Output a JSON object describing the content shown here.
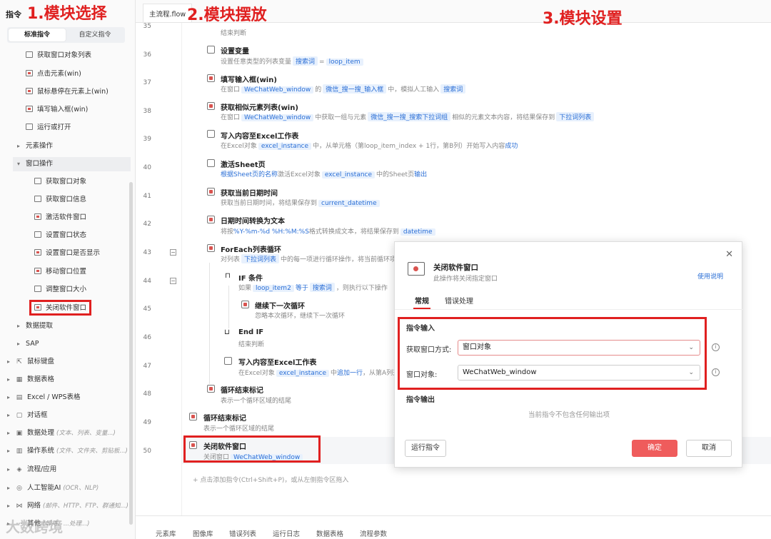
{
  "sidebar": {
    "title": "指令",
    "tabs": [
      "标准指令",
      "自定义指令"
    ],
    "items": [
      {
        "label": "获取窗口对象列表",
        "icon": "window-list-icon"
      },
      {
        "label": "点击元素(win)",
        "icon": "click-element-icon"
      },
      {
        "label": "鼠标悬停在元素上(win)",
        "icon": "hover-element-icon"
      },
      {
        "label": "填写输入框(win)",
        "icon": "fill-input-icon"
      },
      {
        "label": "运行或打开",
        "icon": "run-open-icon"
      }
    ],
    "group_element": "元素操作",
    "group_window": "窗口操作",
    "window_items": [
      {
        "label": "获取窗口对象"
      },
      {
        "label": "获取窗口信息"
      },
      {
        "label": "激活软件窗口"
      },
      {
        "label": "设置窗口状态"
      },
      {
        "label": "设置窗口是否显示"
      },
      {
        "label": "移动窗口位置"
      },
      {
        "label": "调整窗口大小"
      },
      {
        "label": "关闭软件窗口"
      }
    ],
    "group_data_extract": "数据提取",
    "group_sap": "SAP",
    "groups": [
      {
        "label": "鼠标键盘",
        "hint": ""
      },
      {
        "label": "数据表格",
        "hint": ""
      },
      {
        "label": "Excel / WPS表格",
        "hint": ""
      },
      {
        "label": "对话框",
        "hint": ""
      },
      {
        "label": "数据处理",
        "hint": "(文本、列表、变量...)"
      },
      {
        "label": "操作系统",
        "hint": "(文件、文件夹、剪贴板...)"
      },
      {
        "label": "流程/应用",
        "hint": ""
      },
      {
        "label": "人工智能AI",
        "hint": "(OCR、NLP)"
      },
      {
        "label": "网络",
        "hint": "(邮件、HTTP、FTP、群通知...)"
      },
      {
        "label": "其他",
        "hint": "(等待、...处理...)"
      }
    ]
  },
  "annotations": {
    "step1": "1.模块选择",
    "step2": "2.模块摆放",
    "step3": "3.模块设置"
  },
  "editor": {
    "tab": "主流程.flow",
    "add_hint": "+ 点击添加指令(Ctrl+Shift+P)，或从左侧指令区拖入",
    "lines": [
      "35",
      "36",
      "37",
      "38",
      "39",
      "40",
      "41",
      "42",
      "43",
      "44",
      "45",
      "46",
      "47",
      "48",
      "49",
      "50"
    ],
    "steps": {
      "s35_desc": "结束判断",
      "s36_title": "设置变量",
      "s36_desc_a": "设置任意类型的列表变量",
      "s36_var": "搜索词",
      "s36_eq": "=",
      "s36_val": "loop_item",
      "s37_title": "填写输入框(win)",
      "s37_a": "在窗口",
      "s37_win": "WeChatWeb_window",
      "s37_b": "的",
      "s37_el": "微信_搜一搜_输入框",
      "s37_c": "中，模拟人工输入",
      "s37_var": "搜索词",
      "s38_title": "获取相似元素列表(win)",
      "s38_a": "在窗口",
      "s38_win": "WeChatWeb_window",
      "s38_b": "中获取一组与元素",
      "s38_el": "微信_搜一搜_搜索下拉词组",
      "s38_c": "相似的元素文本内容，将结果保存到",
      "s38_var": "下拉词列表",
      "s39_title": "写入内容至Excel工作表",
      "s39_a": "在Excel对象",
      "s39_obj": "excel_instance",
      "s39_b": "中，从单元格（第loop_item_index + 1行，第B列）开始写入内容",
      "s39_c": "成功",
      "s40_title": "激活Sheet页",
      "s40_a": "根据Sheet页的名称",
      "s40_b": "激活Excel对象",
      "s40_obj": "excel_instance",
      "s40_c": "中的Sheet页",
      "s40_d": "输出",
      "s41_title": "获取当前日期时间",
      "s41_a": "获取当前日期时间，将结果保存到",
      "s41_var": "current_datetime",
      "s42_title": "日期时间转换为文本",
      "s42_a": "将按",
      "s42_fmt": "%Y-%m-%d %H:%M:%S",
      "s42_b": "格式转换成文本，将结果保存到",
      "s42_var": "datetime",
      "s43_title": "ForEach列表循环",
      "s43_a": "对列表",
      "s43_var": "下拉词列表",
      "s43_b": "中的每一项进行循环操作，将当前循环项",
      "s44_title": "IF 条件",
      "s44_a": "如果",
      "s44_var": "loop_item2",
      "s44_op": "等于",
      "s44_val": "搜索词",
      "s44_b": "，则执行以下操作",
      "s45_title": "继续下一次循环",
      "s45_desc": "忽略本次循环，继续下一次循环",
      "s46_title": "End IF",
      "s46_desc": "结束判断",
      "s47_title": "写入内容至Excel工作表",
      "s47_a": "在Excel对象",
      "s47_obj": "excel_instance",
      "s47_b": "中",
      "s47_c": "追加一行",
      "s47_d": "，从第A列开",
      "s48_title": "循环结束标记",
      "s48_desc": "表示一个循环区域的结尾",
      "s49_title": "循环结束标记",
      "s49_desc": "表示一个循环区域的结尾",
      "s50_title": "关闭软件窗口",
      "s50_a": "关闭窗口",
      "s50_win": "WeChatWeb_window"
    }
  },
  "bottom_tabs": [
    "元素库",
    "图像库",
    "错误列表",
    "运行日志",
    "数据表格",
    "流程参数"
  ],
  "watermark": "大数跨境",
  "dialog": {
    "title": "关闭软件窗口",
    "subtitle": "此操作将关闭指定窗口",
    "help": "使用说明",
    "tabs": [
      "常规",
      "错误处理"
    ],
    "input_section": "指令输入",
    "field1_label": "获取窗口方式:",
    "field1_value": "窗口对象",
    "field2_label": "窗口对象:",
    "field2_value": "WeChatWeb_window",
    "output_section": "指令输出",
    "no_output": "当前指令不包含任何输出项",
    "run_btn": "运行指令",
    "ok_btn": "确定",
    "cancel_btn": "取消"
  },
  "colors": {
    "accent": "#e02020",
    "link": "#2b6fd6",
    "primary_btn": "#ef5c5c"
  }
}
